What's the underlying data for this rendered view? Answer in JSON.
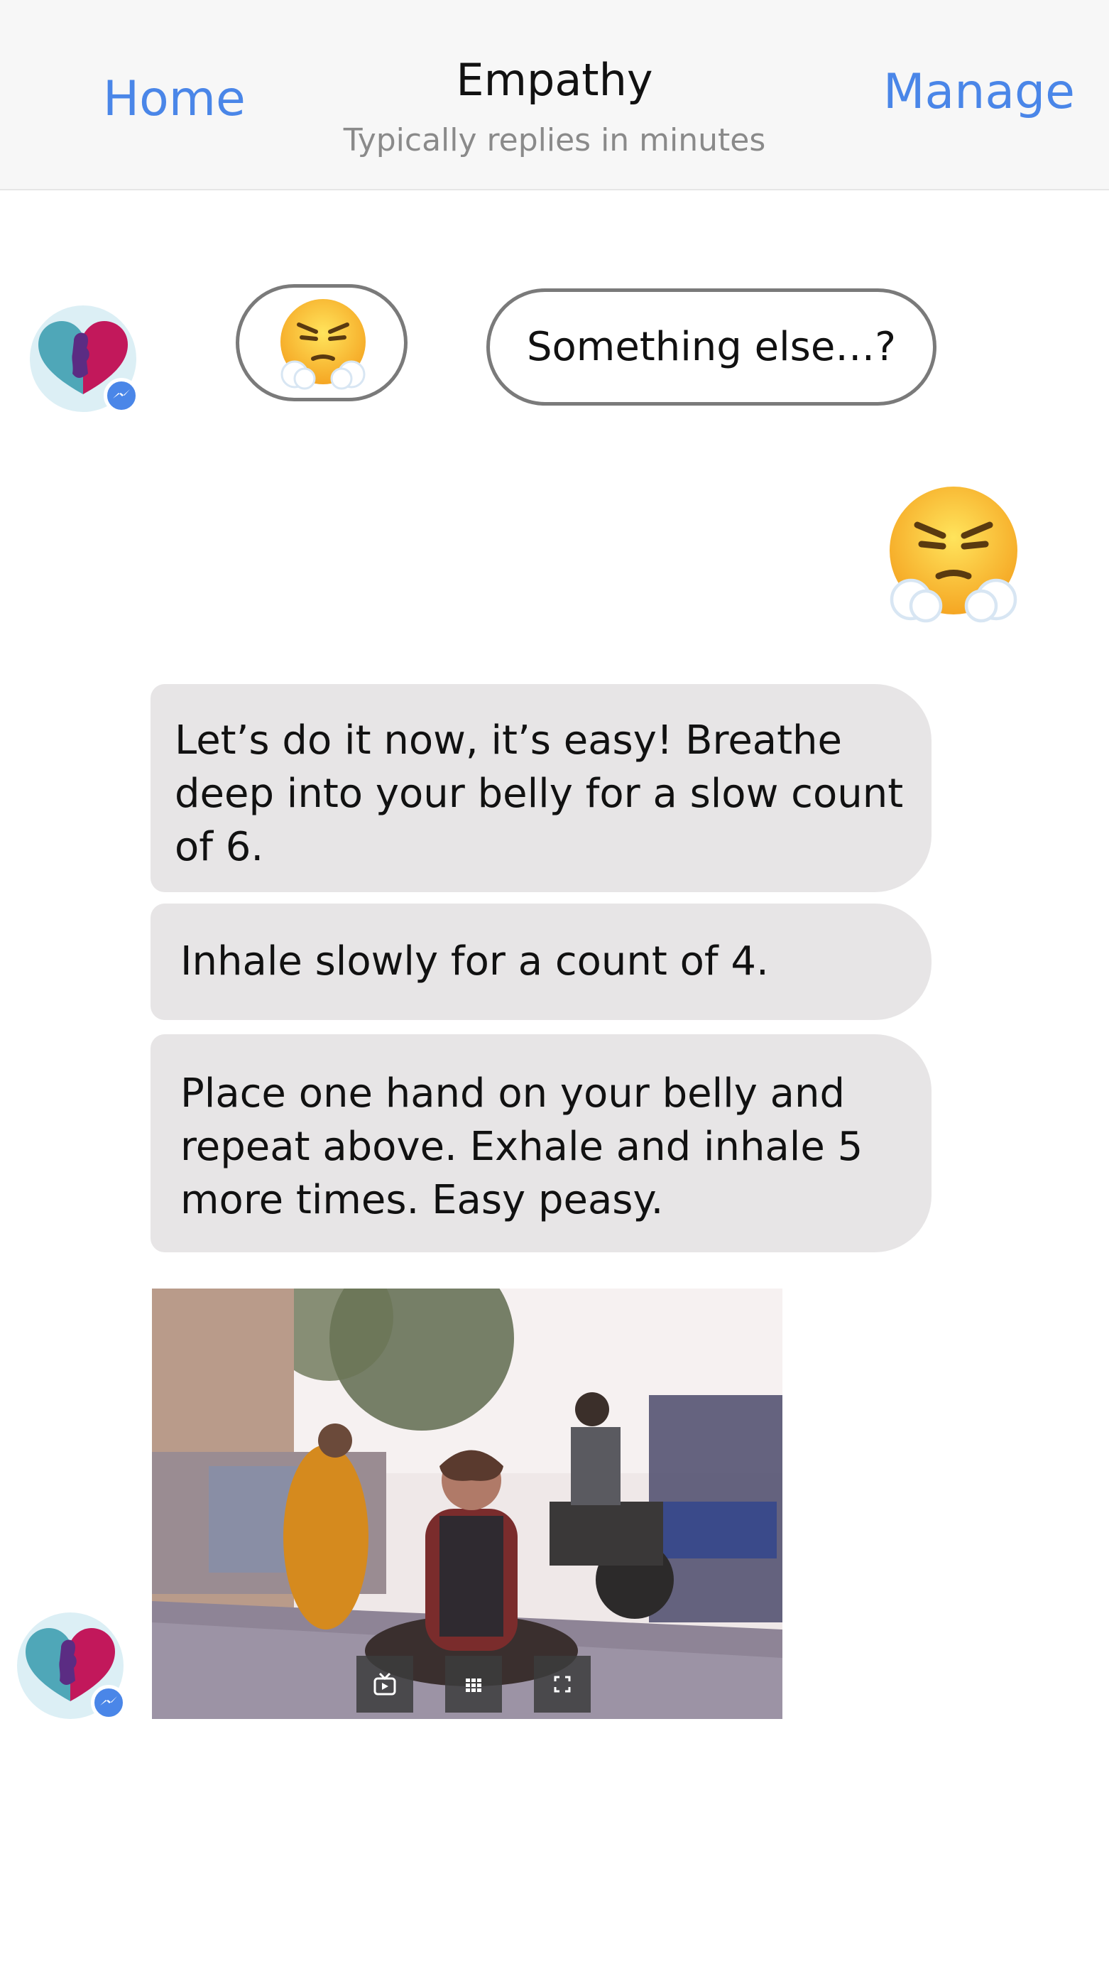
{
  "header": {
    "home_label": "Home",
    "title": "Empathy",
    "subtitle": "Typically replies in minutes",
    "manage_label": "Manage"
  },
  "quick_replies": [
    {
      "type": "emoji",
      "icon": "steam-from-nose-emoji"
    },
    {
      "type": "text",
      "label": "Something else…?"
    }
  ],
  "user_message": {
    "icon": "steam-from-nose-emoji"
  },
  "bot_messages": [
    {
      "text": "Let’s do it now, it’s easy! Breathe deep into your belly for a slow count of 6."
    },
    {
      "text": "Inhale slowly for a count of 4."
    },
    {
      "text": "Place one hand on your belly and repeat above. Exhale and inhale 5 more times. Easy peasy."
    }
  ],
  "image_card": {
    "icon_controls": [
      "tv-icon",
      "grid-icon",
      "fullscreen-icon"
    ]
  },
  "colors": {
    "accent": "#4a86e8",
    "bubble": "#e7e5e6",
    "header_bg": "#f7f7f7"
  }
}
